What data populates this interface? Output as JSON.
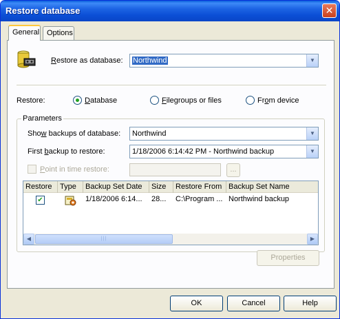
{
  "window": {
    "title": "Restore database",
    "close_glyph": "✕"
  },
  "tabs": [
    {
      "label": "General",
      "active": true
    },
    {
      "label": "Options",
      "active": false
    }
  ],
  "restore_as": {
    "label_prefix": "R",
    "label_rest": "estore as database:",
    "value": "Northwind",
    "icon": "database-backup-icon"
  },
  "restore_mode": {
    "label": "Restore:",
    "options": [
      {
        "prefix": "",
        "u": "D",
        "rest": "atabase",
        "checked": true
      },
      {
        "prefix": "",
        "u": "F",
        "rest": "ilegroups or files",
        "checked": false
      },
      {
        "prefix": "Fr",
        "u": "o",
        "rest": "m device",
        "checked": false
      }
    ]
  },
  "parameters": {
    "legend": "Parameters",
    "show_backups": {
      "label_prefix": "Sho",
      "label_u": "w",
      "label_rest": " backups of database:",
      "value": "Northwind"
    },
    "first_backup": {
      "label_prefix": "First ",
      "label_u": "b",
      "label_rest": "ackup to restore:",
      "value": "1/18/2006 6:14:42 PM - Northwind backup"
    },
    "point_in_time": {
      "label_u": "P",
      "label_rest": "oint in time restore:",
      "checked": false,
      "enabled": false,
      "browse_label": "..."
    }
  },
  "grid": {
    "columns": [
      "Restore",
      "Type",
      "Backup Set Date",
      "Size",
      "Restore From",
      "Backup Set Name"
    ],
    "rows": [
      {
        "restore": true,
        "type_icon": "backup-set-icon",
        "date": "1/18/2006 6:14...",
        "size": "28...",
        "from": "C:\\Program ...",
        "name": "Northwind backup"
      }
    ],
    "scroll_left": "◀",
    "scroll_right": "▶",
    "thumb_grip": "|||"
  },
  "buttons": {
    "properties": "Properties",
    "ok": "OK",
    "cancel": "Cancel",
    "help": "Help"
  },
  "colors": {
    "title_bar": "#0a5fdc",
    "selection": "#316ac5",
    "face": "#ece9d8"
  }
}
